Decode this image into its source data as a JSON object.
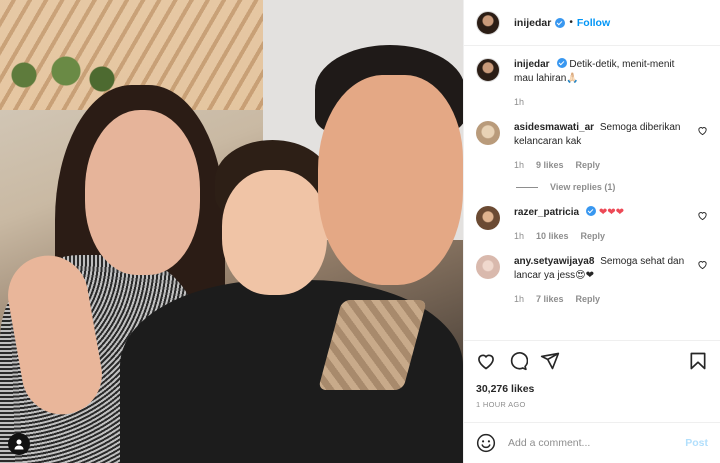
{
  "post": {
    "username": "inijedar",
    "follow_label": "Follow",
    "dot": "•",
    "caption": {
      "username": "inijedar",
      "text": "Detik-detik, menit-menit mau lahiran🙏🏻",
      "time": "1h"
    },
    "comments": [
      {
        "username": "asidesmawati_ar",
        "text": "Semoga diberikan kelancaran kak",
        "time": "1h",
        "likes": "9 likes",
        "reply": "Reply",
        "view_replies": "View replies (1)"
      },
      {
        "username": "razer_patricia",
        "text": "❤❤❤",
        "time": "1h",
        "likes": "10 likes",
        "reply": "Reply"
      },
      {
        "username": "any.setyawijaya8",
        "text": "Semoga sehat dan lancar ya jess😍❤",
        "time": "1h",
        "likes": "7 likes",
        "reply": "Reply"
      }
    ],
    "likes_count": "30,276 likes",
    "timestamp": "1 HOUR AGO",
    "add_comment_placeholder": "Add a comment...",
    "post_label": "Post"
  },
  "icons": {
    "verified": "verified-badge-icon",
    "heart": "heart-icon",
    "comment": "comment-icon",
    "share": "share-icon",
    "save": "bookmark-icon",
    "emoji": "emoji-icon",
    "user": "user-tag-icon"
  },
  "colors": {
    "accent": "#0095f6",
    "muted": "#8e8e8e",
    "text": "#262626",
    "post_disabled": "#b2dffc"
  }
}
